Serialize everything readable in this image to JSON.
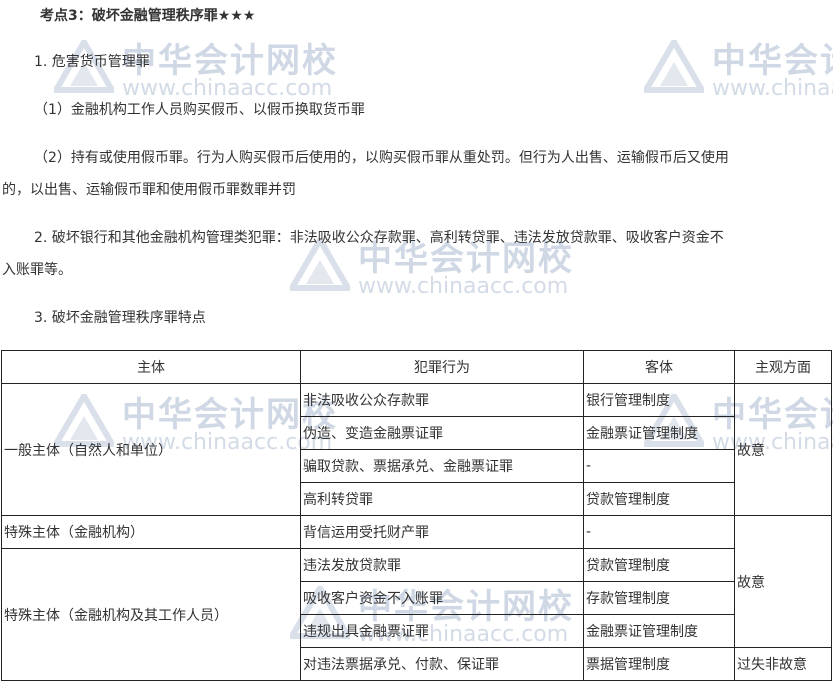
{
  "heading": "考点3：破坏金融管理秩序罪★★★",
  "paragraphs": {
    "p1": "1. 危害货币管理罪",
    "p2": "（1）金融机构工作人员购买假币、以假币换取货币罪",
    "p3_line1": "（2）持有或使用假币罪。行为人购买假币后使用的，以购买假币罪从重处罚。但行为人出售、运输假币后又使用",
    "p3_line2": "的，以出售、运输假币罪和使用假币罪数罪并罚",
    "p4_line1": "2. 破坏银行和其他金融机构管理类犯罪：非法吸收公众存款罪、高利转贷罪、违法发放贷款罪、吸收客户资金不",
    "p4_line2": "入账罪等。",
    "p5": "3. 破坏金融管理秩序罪特点"
  },
  "table": {
    "headers": [
      "主体",
      "犯罪行为",
      "客体",
      "主观方面"
    ],
    "groups": {
      "general_subject": "一般主体（自然人和单位）",
      "special_subject_institution": "特殊主体（金融机构）",
      "special_subject_staff": "特殊主体（金融机构及其工作人员）",
      "intent_1": "故意",
      "intent_2": "故意",
      "negligence": "过失非故意"
    },
    "rows": [
      {
        "act": "非法吸收公众存款罪",
        "object": "银行管理制度"
      },
      {
        "act": "伪造、变造金融票证罪",
        "object": "金融票证管理制度"
      },
      {
        "act": "骗取贷款、票据承兑、金融票证罪",
        "object": "-"
      },
      {
        "act": "高利转贷罪",
        "object": "贷款管理制度"
      },
      {
        "act": "背信运用受托财产罪",
        "object": "-"
      },
      {
        "act": "违法发放贷款罪",
        "object": "贷款管理制度"
      },
      {
        "act": "吸收客户资金不入账罪",
        "object": "存款管理制度"
      },
      {
        "act": "违规出具金融票证罪",
        "object": "金融票证管理制度"
      },
      {
        "act": "对违法票据承兑、付款、保证罪",
        "object": "票据管理制度"
      }
    ]
  },
  "watermark": {
    "cn": "中华会计网校",
    "en": "www.chinaacc.com"
  },
  "colors": {
    "watermark": "#cfd8e4",
    "text": "#333333",
    "border": "#222222"
  }
}
